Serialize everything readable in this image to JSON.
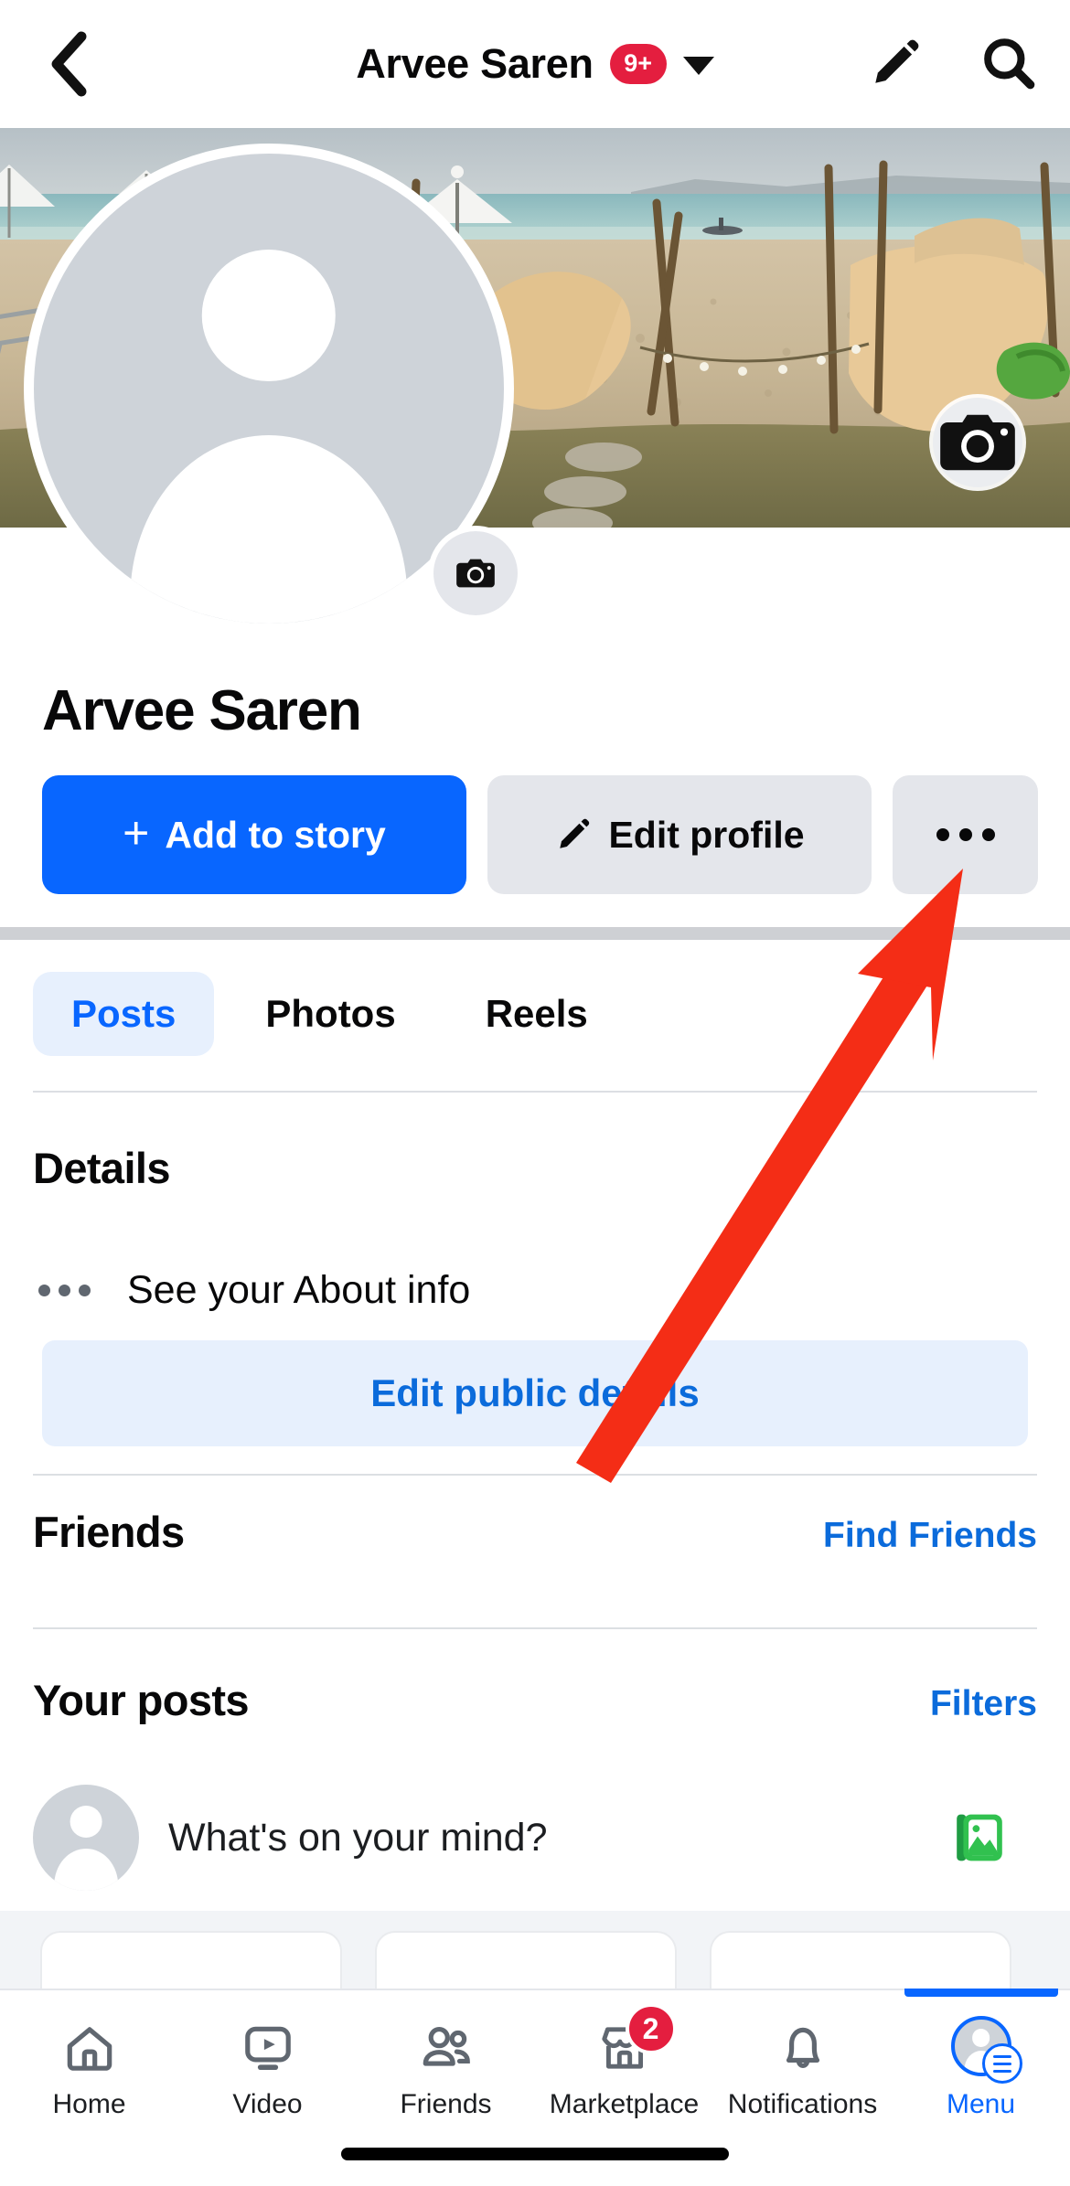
{
  "header": {
    "back_icon": "chevron-left-icon",
    "title": "Arvee Saren",
    "badge": "9+",
    "dropdown_icon": "chevron-down-icon",
    "edit_icon": "pencil-icon",
    "search_icon": "search-icon"
  },
  "cover": {
    "camera_icon": "camera-icon",
    "description": "beach-cover-photo"
  },
  "profile": {
    "avatar_icon": "default-avatar-icon",
    "camera_icon": "camera-icon",
    "name": "Arvee Saren"
  },
  "actions": {
    "add_to_story": "Add to story",
    "plus": "+",
    "edit_profile": "Edit profile",
    "edit_icon": "pencil-icon",
    "more_icon": "ellipsis-icon"
  },
  "tabs": [
    {
      "label": "Posts",
      "active": true
    },
    {
      "label": "Photos",
      "active": false
    },
    {
      "label": "Reels",
      "active": false
    }
  ],
  "details": {
    "heading": "Details",
    "about_icon": "ellipsis-icon",
    "about_text": "See your About info",
    "edit_public_details": "Edit public details"
  },
  "friends": {
    "heading": "Friends",
    "link": "Find Friends"
  },
  "your_posts": {
    "heading": "Your posts",
    "link": "Filters"
  },
  "composer": {
    "avatar_icon": "default-avatar-icon",
    "placeholder": "What's on your mind?",
    "photo_icon": "photo-library-icon"
  },
  "bottom_nav": [
    {
      "label": "Home",
      "icon": "home-icon",
      "active": false,
      "badge": ""
    },
    {
      "label": "Video",
      "icon": "video-icon",
      "active": false,
      "badge": ""
    },
    {
      "label": "Friends",
      "icon": "friends-icon",
      "active": false,
      "badge": ""
    },
    {
      "label": "Marketplace",
      "icon": "marketplace-icon",
      "active": false,
      "badge": "2"
    },
    {
      "label": "Notifications",
      "icon": "bell-icon",
      "active": false,
      "badge": ""
    },
    {
      "label": "Menu",
      "icon": "menu-avatar-icon",
      "active": true,
      "badge": ""
    }
  ],
  "annotation": {
    "type": "red-arrow",
    "color": "#f42d16",
    "points_to": "more-options-button"
  },
  "colors": {
    "primary_blue": "#0866ff",
    "link_blue": "#0b6bdb",
    "badge_red": "#e41e3f",
    "button_gray": "#e4e6eb",
    "pill_blue_bg": "#e7f0fd",
    "text_dark": "#080809"
  }
}
